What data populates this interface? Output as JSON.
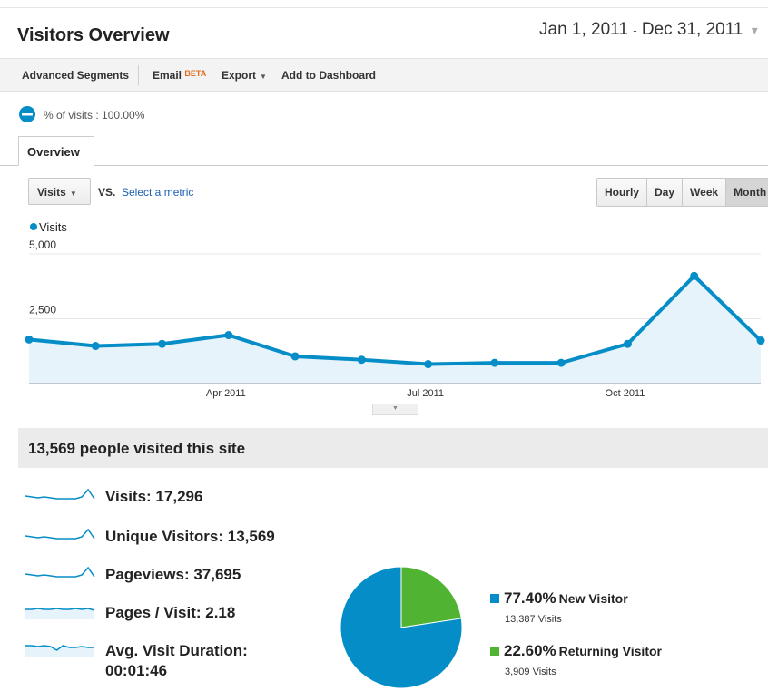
{
  "header": {
    "title": "Visitors Overview",
    "date_start": "Jan 1, 2011",
    "date_sep": "-",
    "date_end": "Dec 31, 2011"
  },
  "toolbar": {
    "advanced_segments": "Advanced Segments",
    "email": "Email",
    "email_badge": "BETA",
    "export": "Export",
    "add_to_dashboard": "Add to Dashboard"
  },
  "segment": {
    "text": "% of visits : 100.00%"
  },
  "tabs": [
    {
      "label": "Overview"
    }
  ],
  "controls": {
    "metric": "Visits",
    "vs": "VS.",
    "select_metric": "Select a metric",
    "granularity": [
      "Hourly",
      "Day",
      "Week",
      "Month"
    ],
    "active_granularity": "Month"
  },
  "chart_data": {
    "type": "area",
    "series": [
      {
        "name": "Visits",
        "values": [
          1700,
          1450,
          1530,
          1870,
          1050,
          920,
          750,
          800,
          800,
          1530,
          4150,
          1660
        ]
      }
    ],
    "x": [
      "Jan 2011",
      "Feb 2011",
      "Mar 2011",
      "Apr 2011",
      "May 2011",
      "Jun 2011",
      "Jul 2011",
      "Aug 2011",
      "Sep 2011",
      "Oct 2011",
      "Nov 2011",
      "Dec 2011"
    ],
    "xticks": [
      "Apr 2011",
      "Jul 2011",
      "Oct 2011"
    ],
    "yticks": [
      "5,000",
      "2,500"
    ],
    "ylim": [
      0,
      5000
    ],
    "color": "#058dc7",
    "fill": "#e6f3fb"
  },
  "summary": {
    "headline": "13,569 people visited this site",
    "metrics": [
      {
        "label": "Visits: 17,296",
        "spark": "peak"
      },
      {
        "label": "Unique Visitors: 13,569",
        "spark": "peak"
      },
      {
        "label": "Pageviews: 37,695",
        "spark": "peak"
      },
      {
        "label": "Pages / Visit: 2.18",
        "spark": "flat"
      },
      {
        "label": "Avg. Visit Duration:",
        "label2": "00:01:46",
        "spark": "dip"
      }
    ]
  },
  "pie": {
    "slices": [
      {
        "name": "New Visitor",
        "pct_label": "77.40%",
        "value": 77.4,
        "visits": "13,387 Visits",
        "color": "#058dc7"
      },
      {
        "name": "Returning Visitor",
        "pct_label": "22.60%",
        "value": 22.6,
        "visits": "3,909 Visits",
        "color": "#50b432"
      }
    ]
  }
}
